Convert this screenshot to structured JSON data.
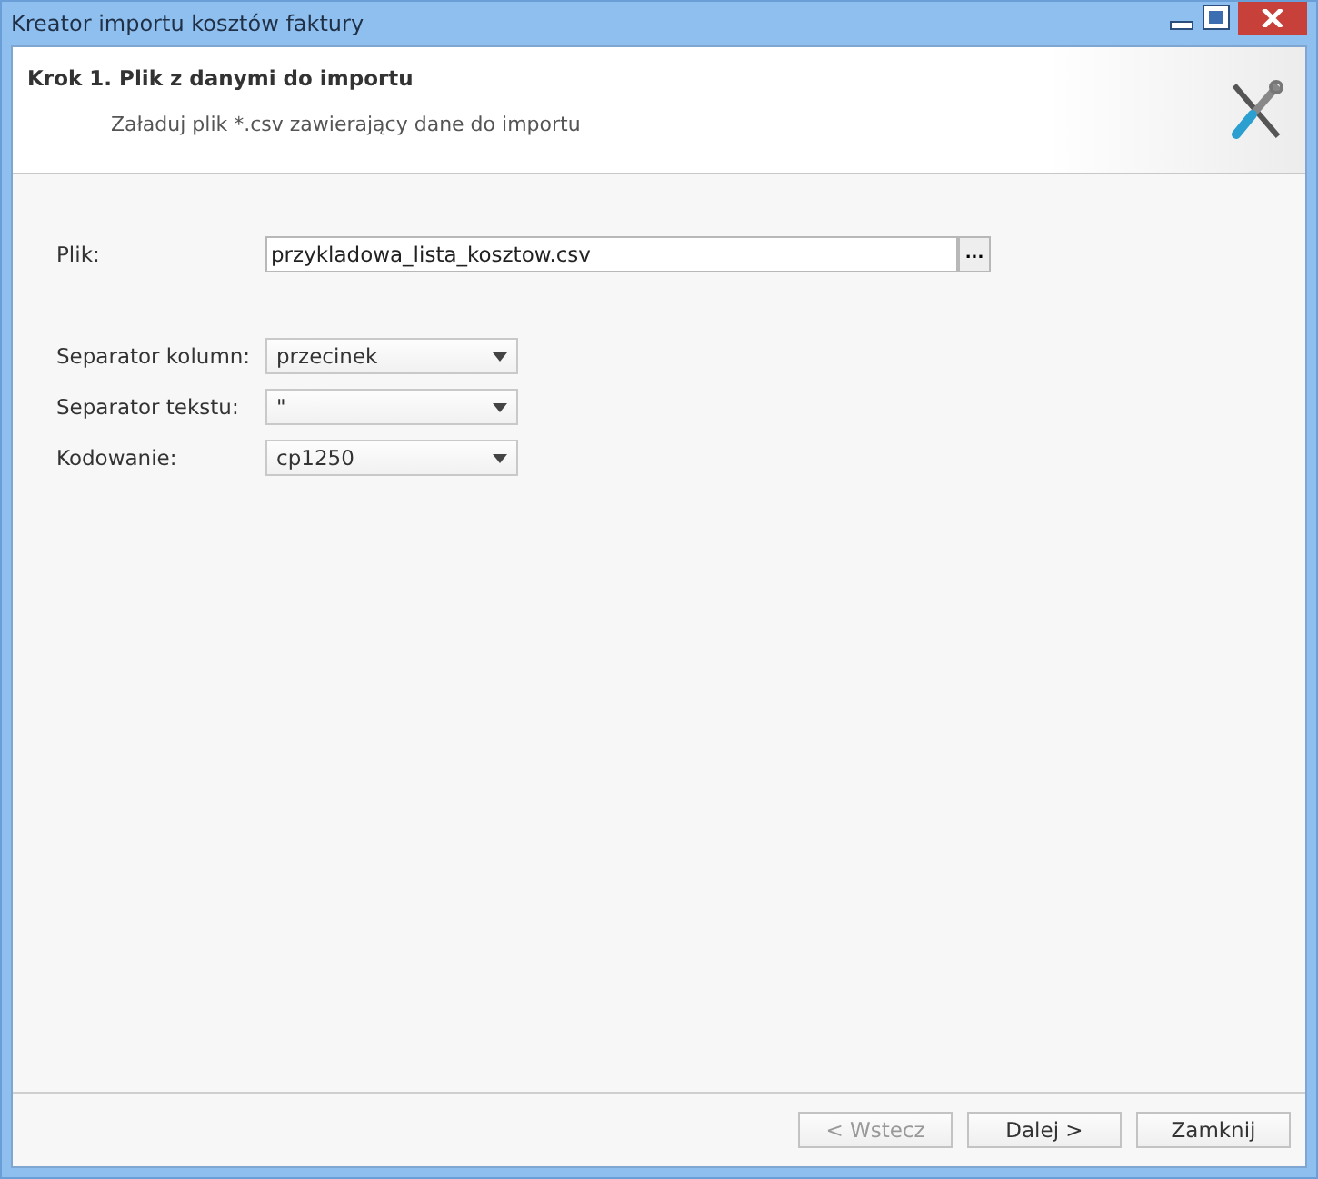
{
  "window": {
    "title": "Kreator importu kosztów faktury"
  },
  "header": {
    "title": "Krok 1. Plik z danymi do importu",
    "subtitle": "Załaduj plik *.csv zawierający dane do importu"
  },
  "file": {
    "label": "Plik:",
    "value": "przykladowa_lista_kosztow.csv",
    "browse": "..."
  },
  "selects": [
    {
      "label": "Separator kolumn:",
      "value": "przecinek"
    },
    {
      "label": "Separator tekstu:",
      "value": "\""
    },
    {
      "label": "Kodowanie:",
      "value": "cp1250"
    }
  ],
  "buttons": [
    {
      "label": "< Wstecz",
      "disabled": true
    },
    {
      "label": "Dalej >",
      "disabled": false
    },
    {
      "label": "Zamknij",
      "disabled": false
    }
  ]
}
